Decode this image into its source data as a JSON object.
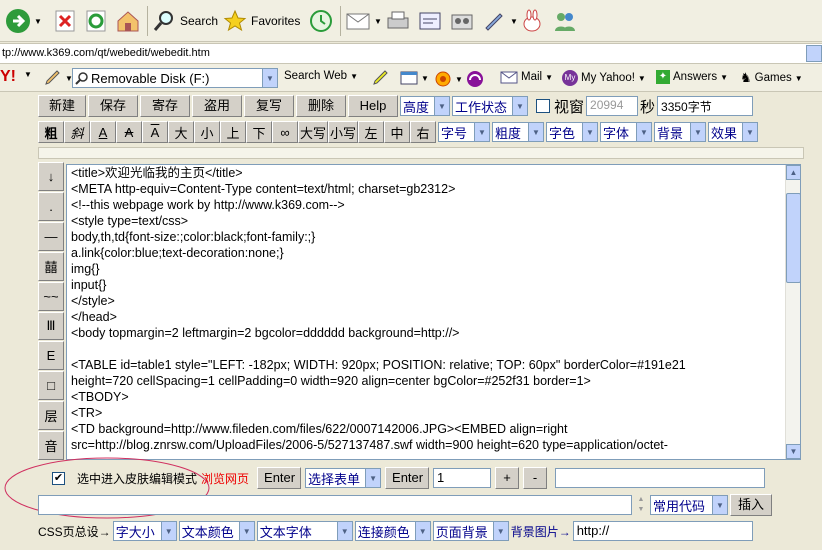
{
  "browser": {
    "search_label": "Search",
    "favorites_label": "Favorites",
    "address": "tp://www.k369.com/qt/webedit/webedit.htm"
  },
  "toolbar3": {
    "disk": "Removable Disk (F:)",
    "search_web": "Search Web",
    "mail": "Mail",
    "yahoo": "My Yahoo!",
    "answers": "Answers",
    "games": "Games"
  },
  "row1": {
    "buttons": [
      "新建",
      "保存",
      "寄存",
      "盗用",
      "复写",
      "删除",
      "Help"
    ],
    "height_sel": "高度",
    "status_sel": "工作状态",
    "window_label": "视窗",
    "num1": "20994",
    "sec_label": "秒",
    "num2": "3350字节"
  },
  "row2": {
    "buttons": [
      "粗",
      "斜",
      "A",
      "A",
      "A",
      "大",
      "小",
      "上",
      "下",
      "∞",
      "大写",
      "小写",
      "左",
      "中",
      "右"
    ],
    "selects": [
      "字号",
      "粗度",
      "字色",
      "字体",
      "背景",
      "效果"
    ]
  },
  "sidebar": [
    "↓",
    ".",
    "—",
    "囍",
    "~~",
    "Ⅲ",
    "E",
    "□",
    "层",
    "音"
  ],
  "editor": {
    "lines": [
      "<title>欢迎光临我的主页</title>",
      "<META http-equiv=Content-Type content=text/html; charset=gb2312>",
      "<!--this webpage work by http://www.k369.com-->",
      "<style type=text/css>",
      "body,th,td{font-size:;color:black;font-family:;}",
      "a.link{color:blue;text-decoration:none;}",
      "img{}",
      "input{}",
      "</style>",
      "</head>",
      "<body topmargin=2 leftmargin=2 bgcolor=dddddd background=http://>",
      "",
      "<TABLE id=table1 style=\"LEFT: -182px; WIDTH: 920px; POSITION: relative; TOP: 60px\" borderColor=#191e21",
      "height=720 cellSpacing=1 cellPadding=0 width=920 align=center bgColor=#252f31 border=1>",
      "<TBODY>",
      "<TR>",
      "<TD background=http://www.fileden.com/files/622/0007142006.JPG><EMBED align=right",
      "src=http://blog.znrsw.com/UploadFiles/2006-5/527137487.swf width=900 height=620 type=application/octet-"
    ]
  },
  "row4": {
    "checkbox_label": "选中进入皮肤编辑模式",
    "browse_link": "浏览网页",
    "enter1": "Enter",
    "select_form": "选择表单",
    "enter2": "Enter",
    "num_value": "1",
    "plus": "+",
    "minus": "-"
  },
  "row5": {
    "common_code": "常用代码",
    "insert": "插入"
  },
  "row6": {
    "css_label": "CSS页总设→",
    "selects": [
      "字大小",
      "文本颜色",
      "文本字体",
      "连接颜色",
      "页面背景"
    ],
    "bg_image_label": "背景图片→",
    "bg_input": "http://"
  }
}
